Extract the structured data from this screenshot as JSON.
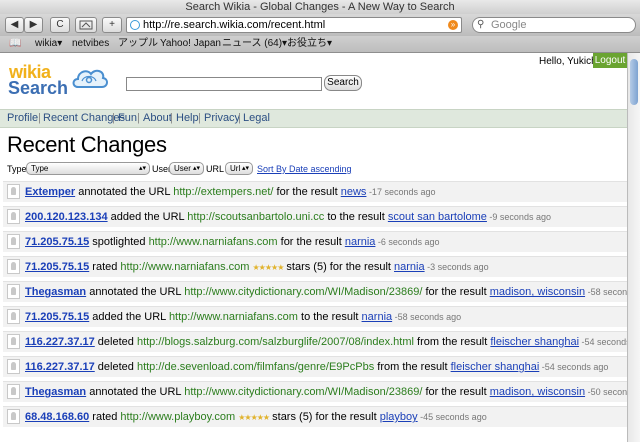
{
  "window": {
    "title": "Search Wikia - Global Changes - A New Way to Search"
  },
  "toolbar": {
    "back": "◀",
    "forward": "▶",
    "reload": "C",
    "add": "+",
    "url": "http://re.search.wikia.com/recent.html",
    "search_placeholder": "Google"
  },
  "bookmarks": [
    "wikia▾",
    "netvibes",
    "アップル",
    "Yahoo! Japan",
    "ニュース (64)▾",
    "お役立ち▾"
  ],
  "page": {
    "logo_top": "wikia",
    "logo_bottom": "Search",
    "greeting": "Hello, Yukichi",
    "logout": "Logout",
    "search_button": "Search",
    "nav": [
      "Profile",
      "Recent Changes",
      "Fun",
      "About",
      "Help",
      "Privacy",
      "Legal"
    ],
    "heading": "Recent Changes",
    "filters": {
      "type_label": "Type",
      "type_value": "Type",
      "user_label": "User",
      "user_value": "User",
      "url_label": "URL",
      "url_value": "Url",
      "sort_link": "Sort By Date ascending"
    },
    "rows": [
      {
        "user": "Extemper",
        "action": " annotated the URL ",
        "url": "http://extempers.net/",
        "mid": " for the result ",
        "result": "news",
        "ago": " -17 seconds ago",
        "stars": ""
      },
      {
        "user": "200.120.123.134",
        "action": " added the URL ",
        "url": "http://scoutsanbartolo.uni.cc",
        "mid": " to the result ",
        "result": "scout san bartolome",
        "ago": " -9 seconds ago",
        "stars": ""
      },
      {
        "user": "71.205.75.15",
        "action": " spotlighted ",
        "url": "http://www.narniafans.com",
        "mid": " for the result ",
        "result": "narnia",
        "ago": " -6 seconds ago",
        "stars": ""
      },
      {
        "user": "71.205.75.15",
        "action": " rated ",
        "url": "http://www.narniafans.com",
        "mid": " stars (5) for the result ",
        "result": "narnia",
        "ago": " -3 seconds ago",
        "stars": "★★★★★"
      },
      {
        "user": "Thegasman",
        "action": " annotated the URL ",
        "url": "http://www.citydictionary.com/WI/Madison/23869/",
        "mid": " for the result ",
        "result": "madison, wisconsin",
        "ago": " -58 seconds ago",
        "stars": ""
      },
      {
        "user": "71.205.75.15",
        "action": " added the URL ",
        "url": "http://www.narniafans.com",
        "mid": " to the result ",
        "result": "narnia",
        "ago": " -58 seconds ago",
        "stars": ""
      },
      {
        "user": "116.227.37.17",
        "action": " deleted ",
        "url": "http://blogs.salzburg.com/salzburglife/2007/08/index.html",
        "mid": " from the result ",
        "result": "fleischer shanghai",
        "ago": " -54 seconds ago",
        "stars": ""
      },
      {
        "user": "116.227.37.17",
        "action": " deleted ",
        "url": "http://de.sevenload.com/filmfans/genre/E9PcPbs",
        "mid": " from the result ",
        "result": "fleischer shanghai",
        "ago": " -54 seconds ago",
        "stars": ""
      },
      {
        "user": "Thegasman",
        "action": " annotated the URL ",
        "url": "http://www.citydictionary.com/WI/Madison/23869/",
        "mid": " for the result ",
        "result": "madison, wisconsin",
        "ago": " -50 seconds ago",
        "stars": ""
      },
      {
        "user": "68.48.168.60",
        "action": " rated ",
        "url": "http://www.playboy.com",
        "mid": " stars (5) for the result ",
        "result": "playboy",
        "ago": " -45 seconds ago",
        "stars": "★★★★★"
      }
    ]
  }
}
